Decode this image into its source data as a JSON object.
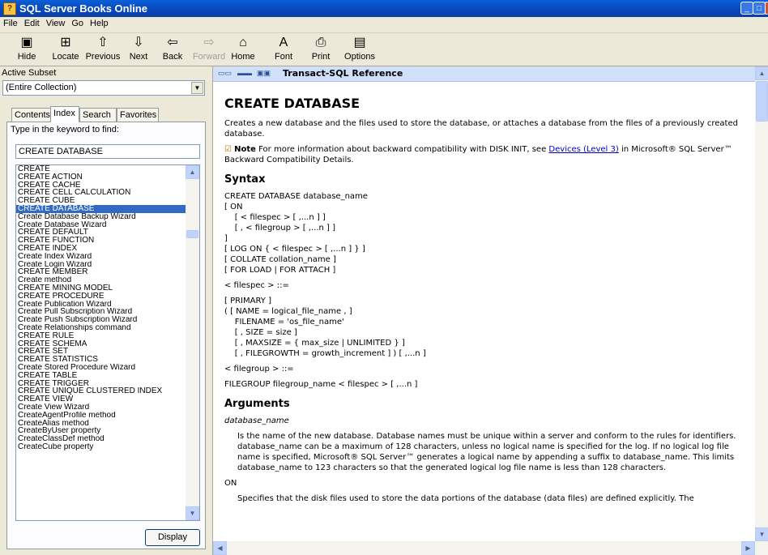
{
  "window": {
    "title": "SQL Server Books Online"
  },
  "menu": [
    "File",
    "Edit",
    "View",
    "Go",
    "Help"
  ],
  "toolbar": [
    {
      "label": "Hide",
      "icon": "hide-icon",
      "glyph": "▣"
    },
    {
      "label": "Locate",
      "icon": "locate-icon",
      "glyph": "⊞"
    },
    {
      "label": "Previous",
      "icon": "previous-icon",
      "glyph": "⇧"
    },
    {
      "label": "Next",
      "icon": "next-icon",
      "glyph": "⇩"
    },
    {
      "label": "Back",
      "icon": "back-icon",
      "glyph": "⇦"
    },
    {
      "label": "Forward",
      "icon": "forward-icon",
      "glyph": "⇨"
    },
    {
      "label": "Home",
      "icon": "home-icon",
      "glyph": "⌂"
    },
    {
      "label": "Font",
      "icon": "font-icon",
      "glyph": "A"
    },
    {
      "label": "Print",
      "icon": "print-icon",
      "glyph": "⎙"
    },
    {
      "label": "Options",
      "icon": "options-icon",
      "glyph": "▤"
    }
  ],
  "subset": {
    "label": "Active Subset",
    "value": "(Entire Collection)"
  },
  "tabs": [
    "Contents",
    "Index",
    "Search",
    "Favorites"
  ],
  "index": {
    "keyword_label": "Type in the keyword to find:",
    "keyword_value": "CREATE DATABASE",
    "items": [
      "CREATE",
      "CREATE ACTION",
      "CREATE CACHE",
      "CREATE CELL CALCULATION",
      "CREATE CUBE",
      "CREATE DATABASE",
      "Create Database Backup Wizard",
      "Create Database Wizard",
      "CREATE DEFAULT",
      "CREATE FUNCTION",
      "CREATE INDEX",
      "Create Index Wizard",
      "Create Login Wizard",
      "CREATE MEMBER",
      "Create method",
      "CREATE MINING MODEL",
      "CREATE PROCEDURE",
      "Create Publication Wizard",
      "Create Pull Subscription Wizard",
      "Create Push Subscription Wizard",
      "Create Relationships command",
      "CREATE RULE",
      "CREATE SCHEMA",
      "CREATE SET",
      "CREATE STATISTICS",
      "Create Stored Procedure Wizard",
      "CREATE TABLE",
      "CREATE TRIGGER",
      "CREATE UNIQUE CLUSTERED INDEX",
      "CREATE VIEW",
      "Create View Wizard",
      "CreateAgentProfile method",
      "CreateAlias method",
      "CreateByUser property",
      "CreateClassDef method",
      "CreateCube property"
    ],
    "selected_index": 5,
    "display_button": "Display"
  },
  "topic": {
    "breadcrumb": "Transact-SQL Reference",
    "heading": "CREATE DATABASE",
    "intro": "Creates a new database and the files used to store the database, or attaches a database from the files of a previously created database.",
    "note_label": "Note",
    "note_text_pre": "For more information about backward compatibility with DISK INIT, see",
    "note_link": "Devices (Level 3)",
    "note_text_post": "in Microsoft® SQL Server™ Backward Compatibility Details.",
    "syntax_heading": "Syntax",
    "syntax_lines": [
      "CREATE DATABASE database_name",
      "[ ON",
      "    [ < filespec > [ ,...n ] ]",
      "    [ , < filegroup > [ ,...n ] ]",
      "]",
      "[ LOG ON { < filespec > [ ,...n ] } ]",
      "[ COLLATE collation_name ]",
      "[ FOR LOAD | FOR ATTACH ]"
    ],
    "filespec_def": "< filespec > ::=",
    "filespec_lines": [
      "[ PRIMARY ]",
      "( [ NAME = logical_file_name , ]",
      "    FILENAME = 'os_file_name'",
      "    [ , SIZE = size ]",
      "    [ , MAXSIZE = { max_size | UNLIMITED } ]",
      "    [ , FILEGROWTH = growth_increment ] ) [ ,...n ]"
    ],
    "filegroup_def": "< filegroup > ::=",
    "filegroup_line": "FILEGROUP filegroup_name < filespec > [ ,...n ]",
    "arguments_heading": "Arguments",
    "arg1_name": "database_name",
    "arg1_desc": "Is the name of the new database. Database names must be unique within a server and conform to the rules for identifiers. database_name can be a maximum of 128 characters, unless no logical name is specified for the log. If no logical log file name is specified, Microsoft® SQL Server™ generates a logical name by appending a suffix to database_name. This limits database_name to 123 characters so that the generated logical log file name is less than 128 characters.",
    "arg2_name": "ON",
    "arg2_desc": "Specifies that the disk files used to store the data portions of the database (data files) are defined explicitly. The"
  }
}
